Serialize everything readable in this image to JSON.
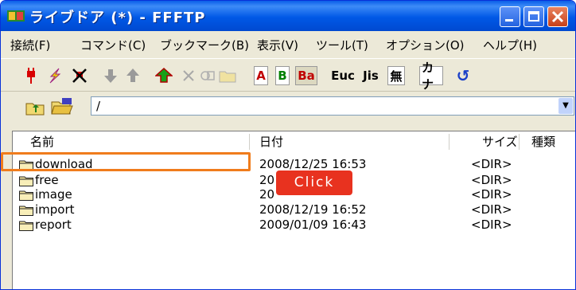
{
  "window": {
    "title": "ライブドア (*) - FFFTP"
  },
  "menu": [
    "接続(F)",
    "コマンド(C)",
    "ブックマーク(B)",
    "表示(V)",
    "ツール(T)",
    "オプション(O)",
    "ヘルプ(H)"
  ],
  "toolbar": {
    "ascii_mode": "A",
    "binary_mode": "B",
    "auto_mode": "Ba",
    "euc": "Euc",
    "jis": "Jis",
    "no_convert": "無",
    "kana": "カナ",
    "refresh": "↺"
  },
  "path": {
    "value": "/"
  },
  "columns": {
    "name": "名前",
    "date": "日付",
    "size": "サイズ",
    "type": "種類"
  },
  "files": [
    {
      "name": "download",
      "date": "2008/12/25 16:53",
      "size": "<DIR>"
    },
    {
      "name": "free",
      "date": "20",
      "size": "<DIR>"
    },
    {
      "name": "image",
      "date": "20",
      "size": "<DIR>"
    },
    {
      "name": "import",
      "date": "2008/12/19 16:52",
      "size": "<DIR>"
    },
    {
      "name": "report",
      "date": "2009/01/09 16:43",
      "size": "<DIR>"
    }
  ],
  "annotation": {
    "label": "Click"
  },
  "colors": {
    "titlebar": "#0058e6",
    "highlight": "#f07c1c",
    "callout": "#e8321f"
  }
}
